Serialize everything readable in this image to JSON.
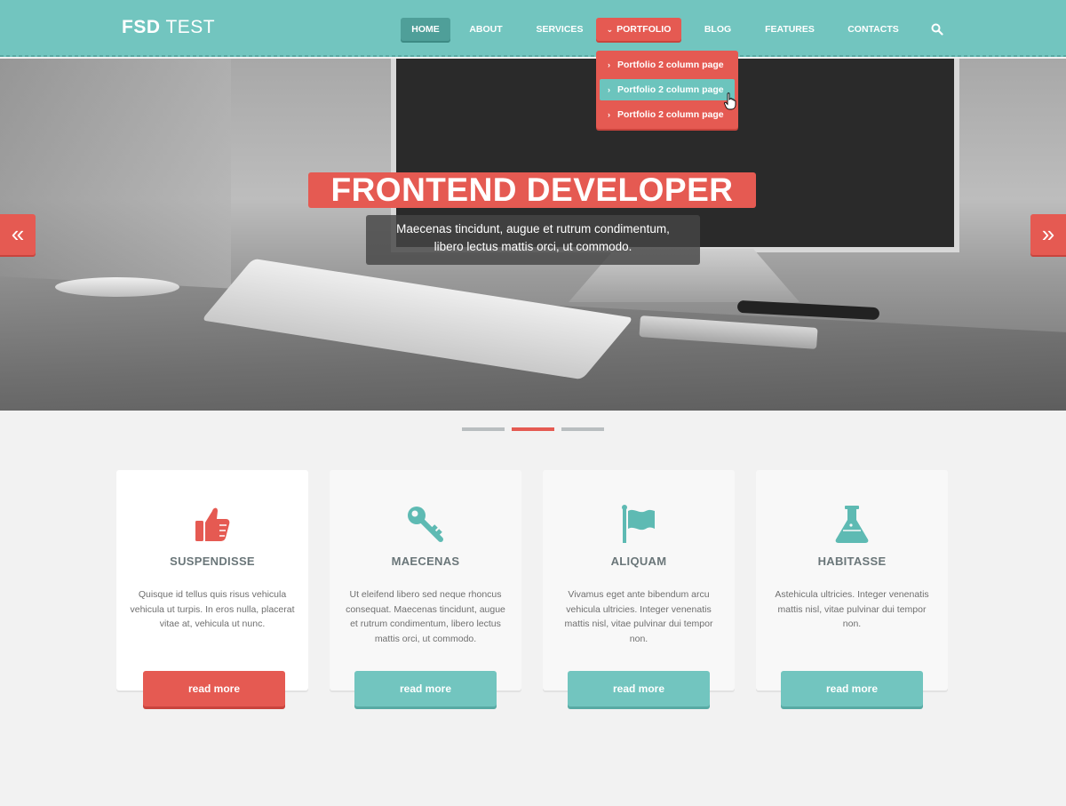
{
  "logo": {
    "bold": "FSD",
    "light": "TEST"
  },
  "nav": {
    "items": [
      {
        "label": "HOME"
      },
      {
        "label": "ABOUT"
      },
      {
        "label": "SERVICES"
      },
      {
        "label": "PORTFOLIO"
      },
      {
        "label": "BLOG"
      },
      {
        "label": "FEATURES"
      },
      {
        "label": "CONTACTS"
      }
    ],
    "active": "HOME",
    "open": "PORTFOLIO"
  },
  "dropdown": {
    "items": [
      {
        "label": "Portfolio 2 column page"
      },
      {
        "label": "Portfolio 2 column page"
      },
      {
        "label": "Portfolio 2 column page"
      }
    ],
    "hovered_index": 1
  },
  "hero": {
    "title": "FRONTEND DEVELOPER",
    "subtitle_line1": "Maecenas tincidunt, augue et rutrum condimentum,",
    "subtitle_line2": "libero lectus mattis orci, ut commodo.",
    "prev_icon": "double-chevron-left-icon",
    "next_icon": "double-chevron-right-icon",
    "slides_total": 3,
    "active_slide": 2
  },
  "cards": [
    {
      "icon": "thumbs-up-icon",
      "title": "SUSPENDISSE",
      "text": "Quisque id tellus quis risus vehicula vehicula ut turpis. In eros nulla, placerat vitae at, vehicula ut nunc.",
      "button": "read more",
      "button_color": "#e55a52"
    },
    {
      "icon": "key-icon",
      "title": "MAECENAS",
      "text": "Ut eleifend libero sed neque rhoncus consequat. Maecenas tincidunt, augue et rutrum condimentum, libero lectus mattis orci, ut commodo.",
      "button": "read more",
      "button_color": "#72c5bf"
    },
    {
      "icon": "flag-icon",
      "title": "ALIQUAM",
      "text": "Vivamus eget ante bibendum arcu vehicula ultricies. Integer venenatis mattis nisl, vitae pulvinar dui tempor non.",
      "button": "read more",
      "button_color": "#72c5bf"
    },
    {
      "icon": "flask-icon",
      "title": "HABITASSE",
      "text": "Astehicula ultricies. Integer venenatis mattis nisl, vitae pulvinar dui tempor non.",
      "button": "read more",
      "button_color": "#72c5bf"
    }
  ],
  "colors": {
    "teal": "#72c5bf",
    "red": "#e55a52",
    "background": "#f2f2f2"
  }
}
